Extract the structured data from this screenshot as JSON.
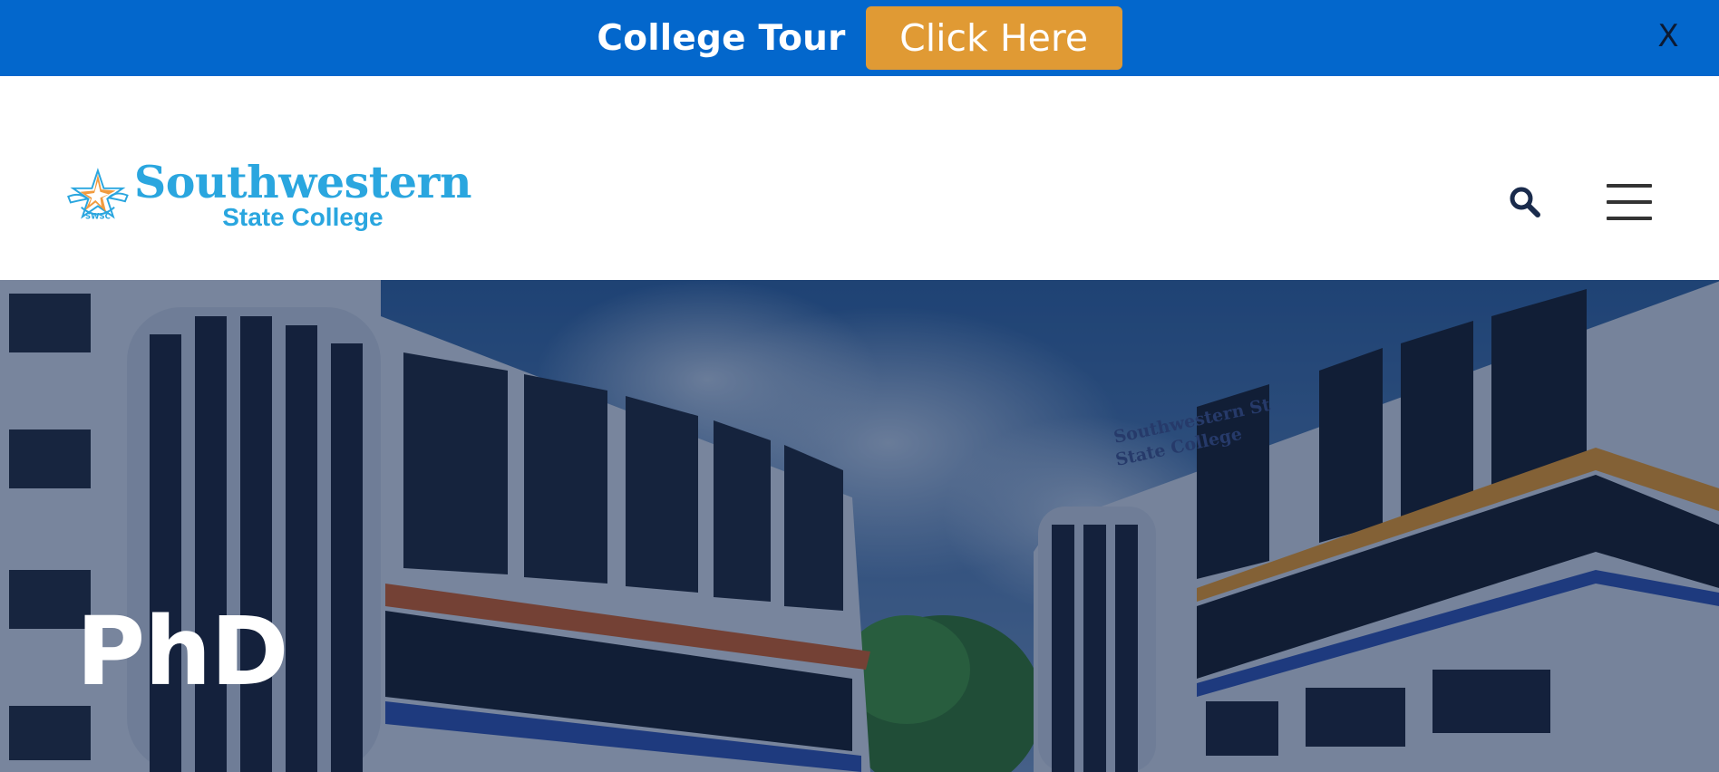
{
  "promo": {
    "title": "College Tour",
    "button_label": "Click Here",
    "close_label": "X",
    "background": "#0367cc",
    "button_color": "#e09a34"
  },
  "header": {
    "logo": {
      "name": "Southwestern",
      "subtitle": "State College",
      "emblem_text": "SWSC",
      "color": "#2aa6df",
      "star_color": "#f0902a"
    },
    "search_icon": "search-icon",
    "menu_icon": "hamburger-menu-icon"
  },
  "hero": {
    "title": "PhD",
    "building_sign_line1": "Southwestern St",
    "building_sign_line2": "State College"
  }
}
